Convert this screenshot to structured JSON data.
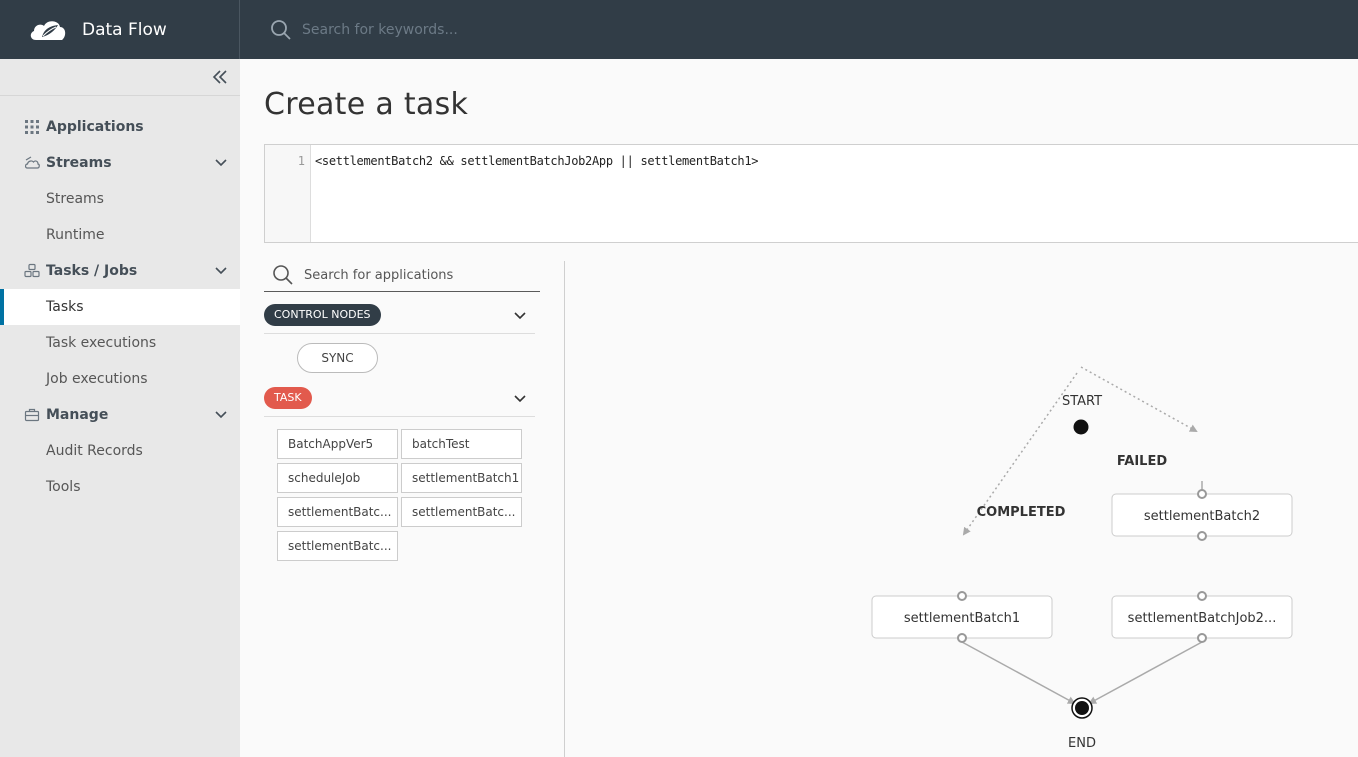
{
  "app": {
    "title": "Data Flow"
  },
  "header": {
    "search_placeholder": "Search for keywords..."
  },
  "sidebar": {
    "groups": [
      {
        "label": "Applications",
        "icon": "grid-icon",
        "items": []
      },
      {
        "label": "Streams",
        "icon": "streams-icon",
        "items": [
          "Streams",
          "Runtime"
        ]
      },
      {
        "label": "Tasks / Jobs",
        "icon": "tasks-icon",
        "items": [
          "Tasks",
          "Task executions",
          "Job executions"
        ]
      },
      {
        "label": "Manage",
        "icon": "briefcase-icon",
        "items": [
          "Audit Records",
          "Tools"
        ]
      }
    ],
    "active_item": "Tasks"
  },
  "main": {
    "title": "Create a task",
    "editor": {
      "line_number": "1",
      "code": "<settlementBatch2 && settlementBatchJob2App || settlementBatch1>"
    },
    "palette": {
      "search_placeholder": "Search for applications",
      "control_nodes_label": "CONTROL NODES",
      "control_nodes": [
        "SYNC"
      ],
      "task_label": "TASK",
      "tasks": [
        "BatchAppVer5",
        "batchTest",
        "scheduleJob",
        "settlementBatch1",
        "settlementBatc...",
        "settlementBatc...",
        "settlementBatc..."
      ]
    },
    "graph": {
      "start_label": "START",
      "end_label": "END",
      "nodes": [
        "settlementBatch2",
        "settlementBatch1",
        "settlementBatchJob2..."
      ],
      "edge_labels": {
        "failed": "FAILED",
        "completed": "COMPLETED"
      }
    }
  }
}
